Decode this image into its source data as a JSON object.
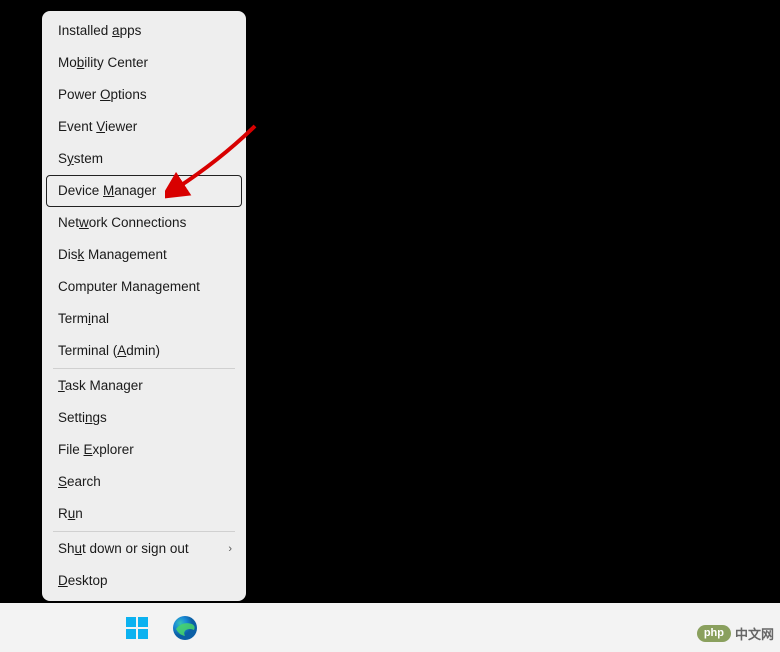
{
  "menu": {
    "group1": [
      {
        "pre": "Installed ",
        "u": "a",
        "post": "pps"
      },
      {
        "pre": "Mo",
        "u": "b",
        "post": "ility Center"
      },
      {
        "pre": "Power ",
        "u": "O",
        "post": "ptions"
      },
      {
        "pre": "Event ",
        "u": "V",
        "post": "iewer"
      },
      {
        "pre": "S",
        "u": "y",
        "post": "stem"
      },
      {
        "pre": "Device ",
        "u": "M",
        "post": "anager",
        "selected": true,
        "name": "device-manager"
      },
      {
        "pre": "Net",
        "u": "w",
        "post": "ork Connections"
      },
      {
        "pre": "Dis",
        "u": "k",
        "post": " Management"
      },
      {
        "pre": "Computer Mana",
        "u": "g",
        "post": "ement"
      },
      {
        "pre": "Term",
        "u": "i",
        "post": "nal"
      },
      {
        "pre": "Terminal (",
        "u": "A",
        "post": "dmin)"
      }
    ],
    "group2": [
      {
        "pre": "",
        "u": "T",
        "post": "ask Manager"
      },
      {
        "pre": "Setti",
        "u": "n",
        "post": "gs"
      },
      {
        "pre": "File ",
        "u": "E",
        "post": "xplorer"
      },
      {
        "pre": "",
        "u": "S",
        "post": "earch"
      },
      {
        "pre": "R",
        "u": "u",
        "post": "n"
      }
    ],
    "group3": [
      {
        "pre": "Sh",
        "u": "u",
        "post": "t down or sign out",
        "submenu": true
      },
      {
        "pre": "",
        "u": "D",
        "post": "esktop"
      }
    ]
  },
  "watermark": {
    "badge": "php",
    "text": "中文网"
  }
}
